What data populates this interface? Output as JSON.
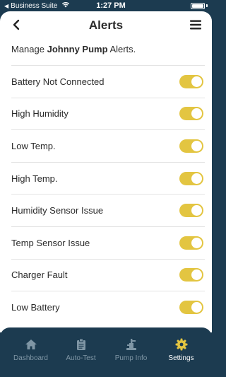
{
  "status_bar": {
    "carrier": "Business Suite",
    "time": "1:27 PM"
  },
  "header": {
    "title": "Alerts"
  },
  "intro": {
    "prefix": "Manage ",
    "pump_name": "Johnny Pump",
    "suffix": " Alerts."
  },
  "alerts": [
    {
      "label": "Battery Not Connected",
      "enabled": true
    },
    {
      "label": "High Humidity",
      "enabled": true
    },
    {
      "label": "Low Temp.",
      "enabled": true
    },
    {
      "label": "High Temp.",
      "enabled": true
    },
    {
      "label": "Humidity Sensor Issue",
      "enabled": true
    },
    {
      "label": "Temp Sensor Issue",
      "enabled": true
    },
    {
      "label": "Charger Fault",
      "enabled": true
    },
    {
      "label": "Low Battery",
      "enabled": true
    }
  ],
  "tabs": [
    {
      "label": "Dashboard",
      "icon": "home-icon",
      "active": false
    },
    {
      "label": "Auto-Test",
      "icon": "clipboard-icon",
      "active": false
    },
    {
      "label": "Pump Info",
      "icon": "pump-icon",
      "active": false
    },
    {
      "label": "Settings",
      "icon": "gear-icon",
      "active": true
    }
  ],
  "colors": {
    "navy": "#1c3b50",
    "toggle_on": "#e3c541",
    "tab_inactive": "#7f96a5",
    "tab_active": "#ffffff"
  }
}
